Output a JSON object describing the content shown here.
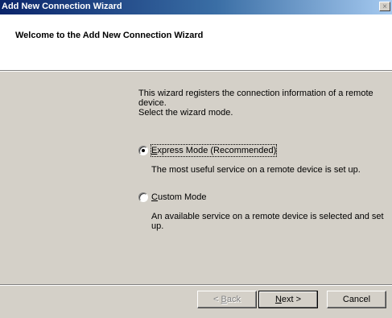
{
  "window": {
    "title": "Add New Connection Wizard",
    "close_glyph": "×"
  },
  "header": {
    "heading": "Welcome to the Add New Connection Wizard"
  },
  "intro": {
    "line1": "This wizard registers the connection information of a remote device.",
    "line2": "Select the wizard mode."
  },
  "modes": [
    {
      "label_accel": "E",
      "label_rest": "xpress Mode (Recommended)",
      "description": "The most useful service on a remote device is set up.",
      "selected": true
    },
    {
      "label_accel": "C",
      "label_rest": "ustom Mode",
      "description": "An available service on a remote device is selected and set up.",
      "selected": false
    }
  ],
  "buttons": {
    "back_prefix": "< ",
    "back_accel": "B",
    "back_rest": "ack",
    "next_accel": "N",
    "next_rest": "ext >",
    "cancel": "Cancel"
  }
}
